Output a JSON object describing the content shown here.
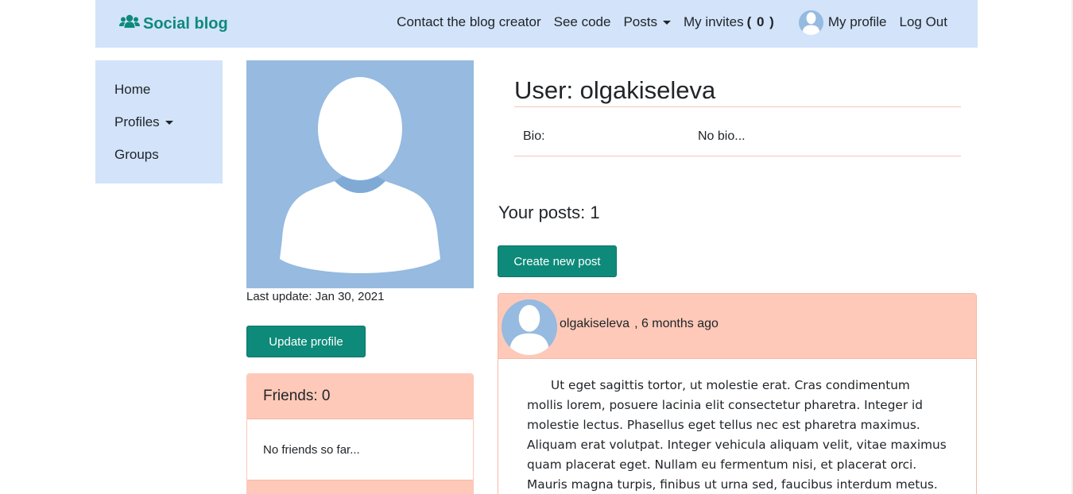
{
  "navbar": {
    "brand": "Social blog",
    "contact": "Contact the blog creator",
    "see_code": "See code",
    "posts": "Posts",
    "invites_label": "My invites",
    "invites_count": "( 0 )",
    "profile": "My profile",
    "logout": "Log Out"
  },
  "sidebar": {
    "items": [
      {
        "label": "Home"
      },
      {
        "label": "Profiles"
      },
      {
        "label": "Groups"
      }
    ]
  },
  "profile": {
    "last_update": "Last update: Jan 30, 2021",
    "update_button": "Update profile",
    "friends_title": "Friends: 0",
    "friends_empty": "No friends so far..."
  },
  "user": {
    "title": "User: olgakiseleva",
    "bio_label": "Bio:",
    "bio_value": "No bio..."
  },
  "posts": {
    "count_title": "Your posts: 1",
    "create_button": "Create new post",
    "items": [
      {
        "author": "olgakiseleva",
        "time": ", 6 months ago",
        "body": "Ut eget sagittis tortor, ut molestie erat. Cras condimentum mollis lorem, posuere lacinia elit consectetur pharetra. Integer id molestie lectus. Phasellus eget tellus nec est pharetra maximus. Aliquam erat volutpat. Integer vehicula aliquam velit, vitae maximus quam placerat eget. Nullam eu fermentum nisi, et placerat orci. Mauris magna turpis, finibus ut urna sed, faucibus interdum metus. Nulla ultricies fringilla"
      }
    ]
  },
  "colors": {
    "brand": "#0e8a7a",
    "nav_background": "#d2e3fa",
    "card_header": "#fec9b8",
    "avatar": "#96bae0"
  },
  "icons": {
    "brand": "users-icon",
    "avatar": "user-silhouette-icon",
    "dropdown": "caret-down-icon"
  }
}
